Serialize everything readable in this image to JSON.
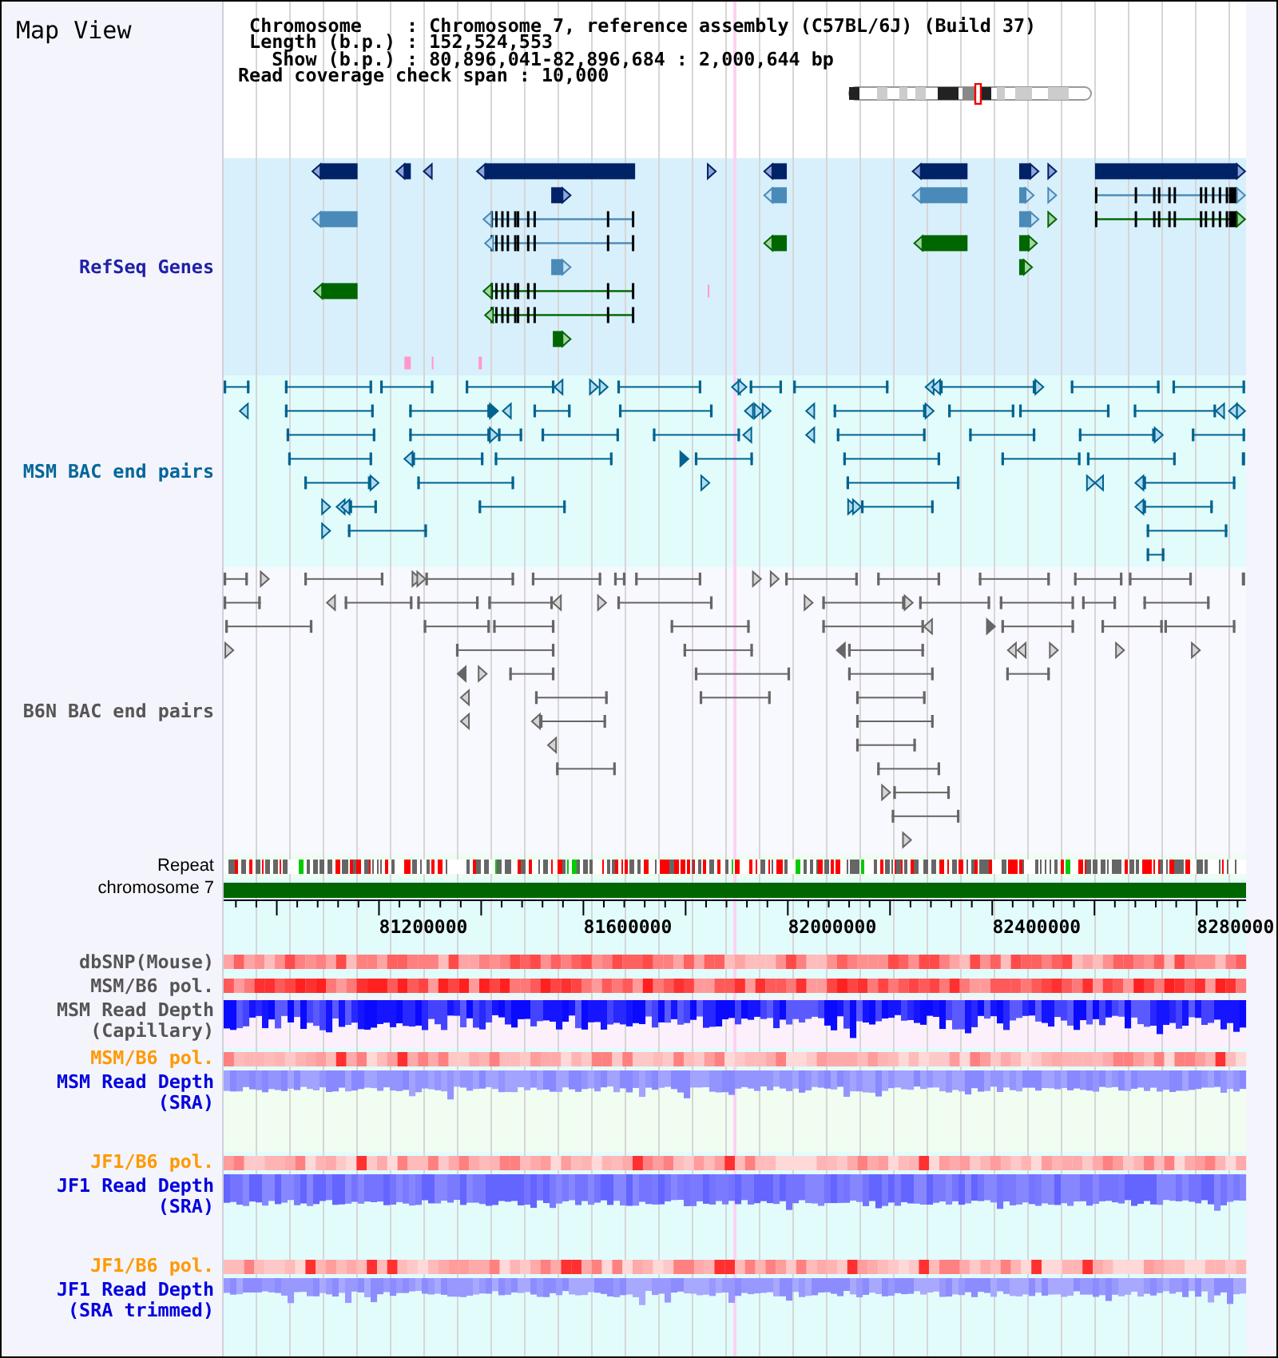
{
  "title": "Map View",
  "info_lines": [
    " Chromosome    : Chromosome 7, reference assembly (C57BL/6J) (Build 37)",
    " Length (b.p.) : 152,524,553",
    "   Show (b.p.) : 80,896,041-82,896,684 : 2,000,644 bp",
    "Read coverage check span : 10,000"
  ],
  "feature_tracks": [
    {
      "label": "RefSeq Genes",
      "color": "#2020a8"
    },
    {
      "label": "MSM BAC end pairs",
      "color": "#006699"
    },
    {
      "label": "B6N BAC end pairs",
      "color": "#555555"
    }
  ],
  "repeat_track": {
    "label": "Repeat"
  },
  "chromosome_track": {
    "label": "chromosome 7"
  },
  "axis": {
    "labels": [
      "81200000",
      "81600000",
      "82000000",
      "82400000",
      "8280000"
    ]
  },
  "data_tracks": [
    {
      "label": "dbSNP(Mouse)",
      "kind": "heatmap",
      "color": "#555555"
    },
    {
      "label": "MSM/B6 pol.",
      "kind": "heatmap",
      "color": "#555555"
    },
    {
      "label": "MSM Read Depth (Capillary)",
      "kind": "depth",
      "color": "#555555"
    },
    {
      "label": "MSM/B6 pol.",
      "kind": "heatmap",
      "color": "#ff9900"
    },
    {
      "label": "MSM Read Depth (SRA)",
      "kind": "depth",
      "color": "#0000dd"
    },
    {
      "label": "JF1/B6 pol.",
      "kind": "heatmap",
      "color": "#ff9900"
    },
    {
      "label": "JF1 Read Depth (SRA)",
      "kind": "depth",
      "color": "#0000dd"
    },
    {
      "label": "JF1/B6 pol.",
      "kind": "heatmap",
      "color": "#ff9900"
    },
    {
      "label": "JF1 Read Depth (SRA trimmed)",
      "kind": "depth",
      "color": "#0000dd"
    }
  ]
}
